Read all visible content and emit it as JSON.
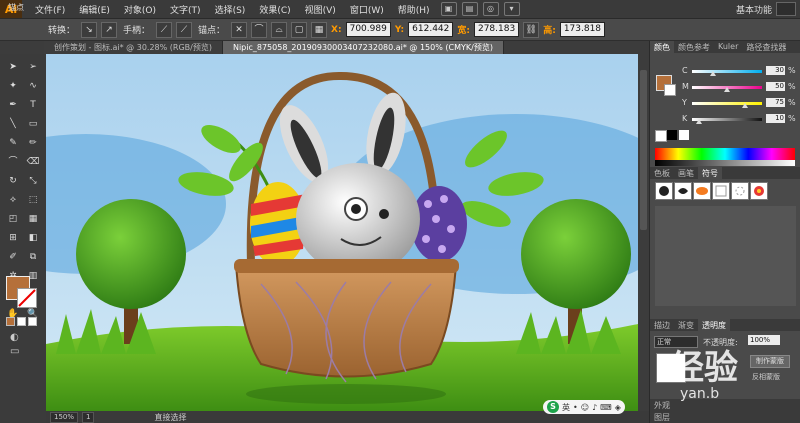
{
  "app": {
    "logo": "Ai"
  },
  "menu": [
    "文件(F)",
    "编辑(E)",
    "对象(O)",
    "文字(T)",
    "选择(S)",
    "效果(C)",
    "视图(V)",
    "窗口(W)",
    "帮助(H)"
  ],
  "workspace": {
    "label": "基本功能"
  },
  "control_bar": {
    "convert_label": "转换：",
    "handle_label": "手柄：",
    "anchor_label": "锚点：",
    "x_label": "X:",
    "x_value": "700.989",
    "y_label": "Y:",
    "y_value": "612.442",
    "w_label": "宽:",
    "w_value": "278.183",
    "h_label": "高:",
    "h_value": "173.818"
  },
  "strip": {
    "left_label": "锚点"
  },
  "tabs": [
    {
      "label": "创作策划 - 图标.ai* @ 30.28% (RGB/预览)",
      "active": false
    },
    {
      "label": "Nipic_875058_20190930003407232080.ai* @ 150% (CMYK/预览)",
      "active": true
    }
  ],
  "colors": {
    "fill": "#b5703a",
    "accent": "#ff9a00"
  },
  "color_panel": {
    "tabs": [
      "颜色",
      "颜色参考",
      "Kuler",
      "路径查找器"
    ],
    "sliders": [
      {
        "label": "C",
        "value": "30",
        "color": "#00aeef",
        "fraction": 0.3
      },
      {
        "label": "M",
        "value": "50",
        "color": "#ec008c",
        "fraction": 0.5
      },
      {
        "label": "Y",
        "value": "75",
        "color": "#fff200",
        "fraction": 0.75
      },
      {
        "label": "K",
        "value": "10",
        "color": "#111111",
        "fraction": 0.1
      }
    ],
    "unit": "%"
  },
  "swatch_panel": {
    "tabs": [
      "色板",
      "画笔",
      "符号"
    ]
  },
  "transparency_panel": {
    "tabs": [
      "描边",
      "渐变",
      "透明度"
    ],
    "blend_mode": "正常",
    "opacity_label": "不透明度:",
    "opacity_value": "100%",
    "mask_button": "制作蒙版",
    "invert_label": "反相蒙版"
  },
  "bottom_panel": {
    "tabs": [
      "外观",
      "图层"
    ]
  },
  "status": {
    "zoom": "150%",
    "page": "1",
    "tool": "直接选择"
  },
  "ime": {
    "lang": "英"
  },
  "watermark": {
    "text": "经验",
    "subtext": "yan.b"
  }
}
